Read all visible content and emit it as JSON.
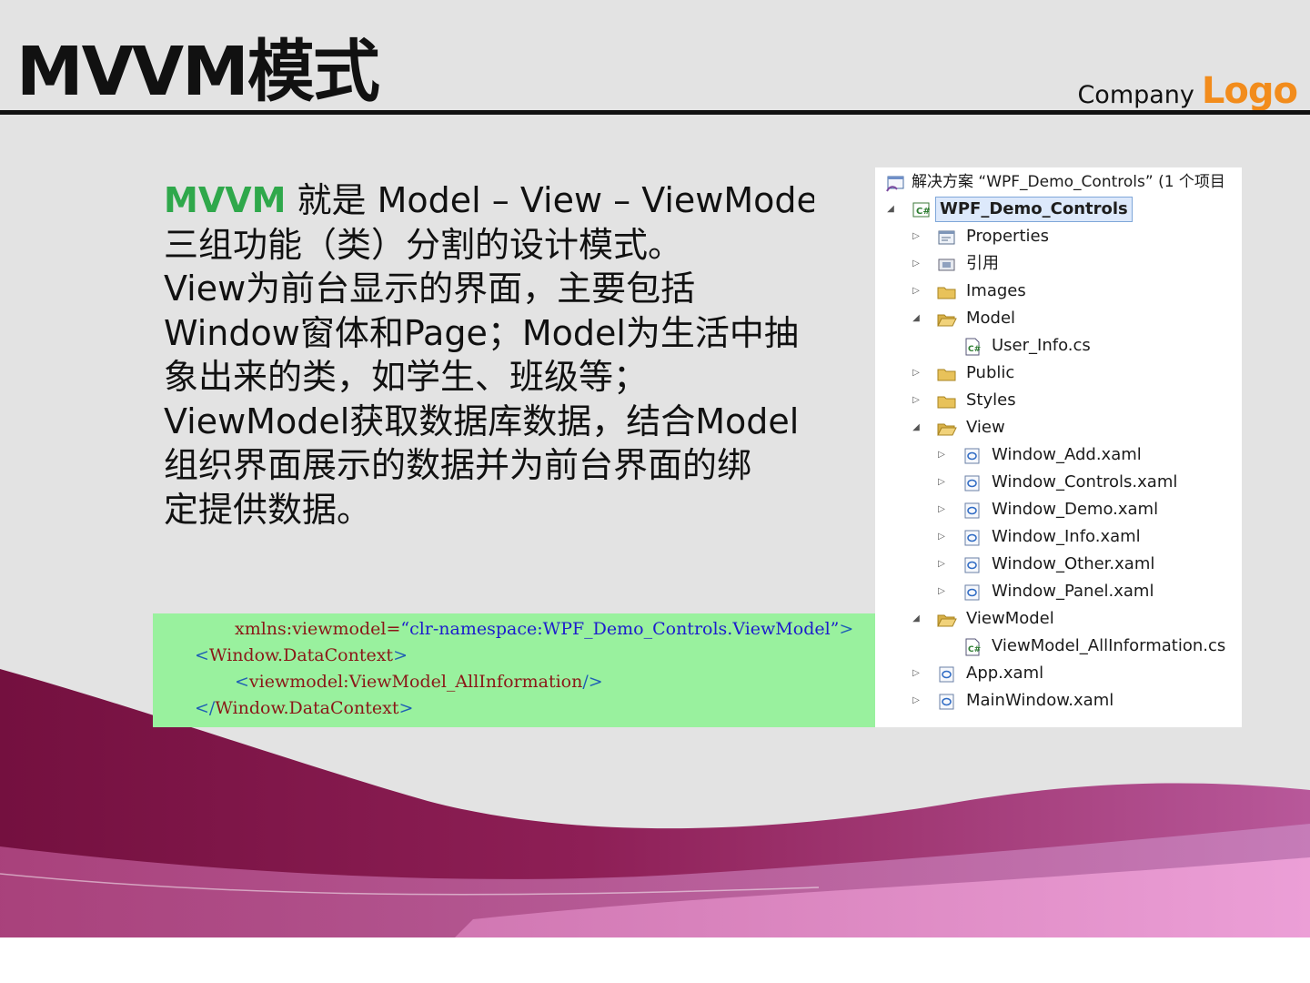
{
  "header": {
    "title": "MVVM模式",
    "company_label": "Company",
    "logo_label": "Logo"
  },
  "content": {
    "lines": [
      {
        "accent": "MVVM",
        "text": " 就是 Model – View – ViewModel"
      },
      {
        "accent": "",
        "text": "三组功能（类）分割的设计模式。"
      },
      {
        "accent": "",
        "text": "View为前台显示的界面，主要包括"
      },
      {
        "accent": "",
        "text": "Window窗体和Page；Model为生活中抽"
      },
      {
        "accent": "",
        "text": "象出来的类，如学生、班级等；"
      },
      {
        "accent": "",
        "text": "ViewModel获取数据库数据，结合Model"
      },
      {
        "accent": "",
        "text": "组织界面展示的数据并为前台界面的绑"
      },
      {
        "accent": "",
        "text": "定提供数据。"
      }
    ]
  },
  "code": {
    "line1": {
      "attr": "xmlns:viewmodel=",
      "value": "“clr-namespace:WPF_Demo_Controls.ViewModel”",
      "close": ">"
    },
    "line2": {
      "open": "<",
      "name": "Window.DataContext",
      "close": ">"
    },
    "line3": {
      "open": "<",
      "name": "viewmodel:ViewModel_AllInformation",
      "close": "/>"
    },
    "line4": {
      "open": "</",
      "name": "Window.DataContext",
      "close": ">"
    }
  },
  "solution_tree": {
    "header": "解决方案 “WPF_Demo_Controls” (1 个项目",
    "nodes": [
      {
        "label": "WPF_Demo_Controls",
        "icon": "csharp-project-icon",
        "expanded": true
      },
      {
        "label": "Properties",
        "icon": "properties-icon",
        "expanded": false
      },
      {
        "label": "引用",
        "icon": "references-icon",
        "expanded": false
      },
      {
        "label": "Images",
        "icon": "folder-icon",
        "expanded": false
      },
      {
        "label": "Model",
        "icon": "folder-open-icon",
        "expanded": true
      },
      {
        "label": "User_Info.cs",
        "icon": "csharp-file-icon"
      },
      {
        "label": "Public",
        "icon": "folder-icon",
        "expanded": false
      },
      {
        "label": "Styles",
        "icon": "folder-icon",
        "expanded": false
      },
      {
        "label": "View",
        "icon": "folder-open-icon",
        "expanded": true
      },
      {
        "label": "Window_Add.xaml",
        "icon": "xaml-file-icon",
        "expanded": false
      },
      {
        "label": "Window_Controls.xaml",
        "icon": "xaml-file-icon",
        "expanded": false
      },
      {
        "label": "Window_Demo.xaml",
        "icon": "xaml-file-icon",
        "expanded": false
      },
      {
        "label": "Window_Info.xaml",
        "icon": "xaml-file-icon",
        "expanded": false
      },
      {
        "label": "Window_Other.xaml",
        "icon": "xaml-file-icon",
        "expanded": false
      },
      {
        "label": "Window_Panel.xaml",
        "icon": "xaml-file-icon",
        "expanded": false
      },
      {
        "label": "ViewModel",
        "icon": "folder-open-icon",
        "expanded": true
      },
      {
        "label": "ViewModel_AllInformation.cs",
        "icon": "csharp-file-icon"
      },
      {
        "label": "App.xaml",
        "icon": "xaml-file-icon",
        "expanded": false
      },
      {
        "label": "MainWindow.xaml",
        "icon": "xaml-file-icon",
        "expanded": false
      }
    ]
  },
  "colors": {
    "accent": "#2fa84b",
    "logo": "#f28c1c",
    "code_background": "#99f19e",
    "wave_dark": "#7a1448",
    "wave_light": "#e07fc3"
  }
}
